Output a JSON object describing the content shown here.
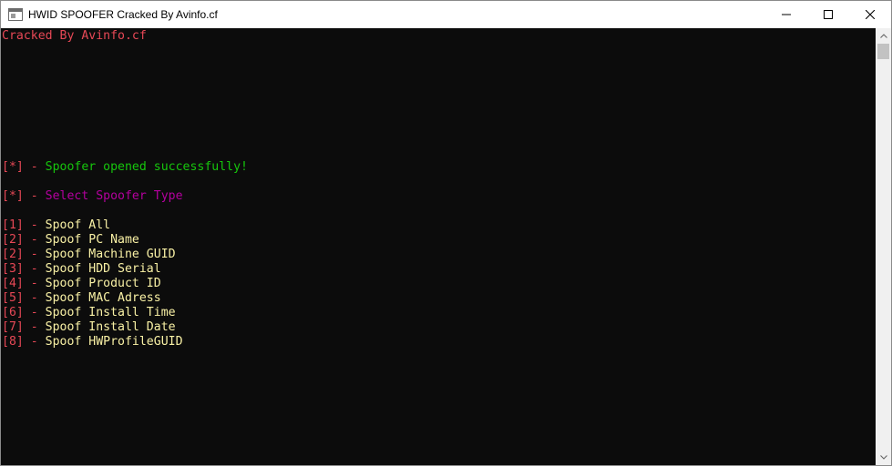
{
  "window": {
    "title": "HWID SPOOFER Cracked By Avinfo.cf",
    "icon": "console-window-icon",
    "controls": [
      "minimize-icon",
      "maximize-icon",
      "close-icon"
    ]
  },
  "console": {
    "colors": {
      "background": "#0c0c0c",
      "red": "#e74856",
      "green": "#16c60c",
      "magenta": "#b4009e",
      "yellow": "#f9f1a5"
    },
    "banner": "Cracked By Avinfo.cf",
    "status": {
      "bracket": "[*]",
      "sep": " - ",
      "text": "Spoofer opened successfully!"
    },
    "prompt": {
      "bracket": "[*]",
      "sep": " - ",
      "text": "Select Spoofer Type"
    },
    "menu": [
      {
        "bracket": "[1]",
        "sep": " - ",
        "label": "Spoof All"
      },
      {
        "bracket": "[2]",
        "sep": " - ",
        "label": "Spoof PC Name"
      },
      {
        "bracket": "[2]",
        "sep": " - ",
        "label": "Spoof Machine GUID"
      },
      {
        "bracket": "[3]",
        "sep": " - ",
        "label": "Spoof HDD Serial"
      },
      {
        "bracket": "[4]",
        "sep": " - ",
        "label": "Spoof Product ID"
      },
      {
        "bracket": "[5]",
        "sep": " - ",
        "label": "Spoof MAC Adress"
      },
      {
        "bracket": "[6]",
        "sep": " - ",
        "label": "Spoof Install Time"
      },
      {
        "bracket": "[7]",
        "sep": " - ",
        "label": "Spoof Install Date"
      },
      {
        "bracket": "[8]",
        "sep": " - ",
        "label": "Spoof HWProfileGUID"
      }
    ]
  },
  "scrollbar": {
    "up": "arrow-up-icon",
    "down": "arrow-down-icon"
  }
}
